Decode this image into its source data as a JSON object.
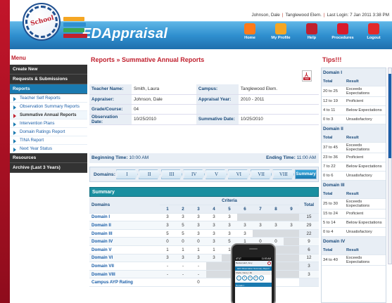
{
  "header": {
    "user": "Johnson, Dale",
    "school": "Tanglewood Elem.",
    "last_login": "Last Login: 7 Jan 2011 3:38 PM",
    "app_title": "EDAppraisal",
    "logo_text": "School",
    "nav": [
      {
        "label": "Home",
        "icon": "home-icon",
        "color": "#ff7a1a"
      },
      {
        "label": "My Profile",
        "icon": "profile-icon",
        "color": "#f5a623"
      },
      {
        "label": "Help",
        "icon": "help-icon",
        "color": "#c0202e"
      },
      {
        "label": "Procedures",
        "icon": "procedures-icon",
        "color": "#d81b2c"
      },
      {
        "label": "Logout",
        "icon": "logout-icon",
        "color": "#e22a2a"
      }
    ]
  },
  "menu": {
    "title": "Menu",
    "sections": [
      {
        "label": "Create New"
      },
      {
        "label": "Requests & Submissions"
      },
      {
        "label": "Reports",
        "items": [
          {
            "label": "Teacher Self Reports"
          },
          {
            "label": "Observation Summary Reports"
          },
          {
            "label": "Summative Annual Reports"
          },
          {
            "label": "Intervention Plans"
          },
          {
            "label": "Domain Ratings Report"
          },
          {
            "label": "TINA Report"
          },
          {
            "label": "Next Year Status"
          }
        ]
      },
      {
        "label": "Resources"
      },
      {
        "label": "Archive (Last 3 Years)"
      }
    ]
  },
  "page": {
    "title": "Reports » Summative Annual Reports",
    "pdf_label": "PDF",
    "info": {
      "teacher_label": "Teacher Name:",
      "teacher": "Smith, Laura",
      "campus_label": "Campus:",
      "campus": "Tanglewood Elem.",
      "appraiser_label": "Appraiser:",
      "appraiser": "Johnson, Dale",
      "year_label": "Appraisal Year:",
      "year": "2010 - 2011",
      "grade_label": "Grade/Course:",
      "grade": "04",
      "obs_label": "Observation Date:",
      "obs": "10/25/2010",
      "summ_label": "Summative Date:",
      "summ": "10/25/2010"
    },
    "begin_label": "Beginning Time:",
    "begin": "10:00 AM",
    "end_label": "Ending Time:",
    "end": "11:00 AM",
    "domains_label": "Domains:",
    "domain_tabs": [
      "I",
      "II",
      "III",
      "IV",
      "V",
      "VI",
      "VII",
      "VIII",
      "Summary"
    ],
    "summary": {
      "title": "Summary",
      "domains_col": "Domains",
      "criteria_col": "Criteria",
      "total_col": "Total",
      "criteria_nums": [
        "1",
        "2",
        "3",
        "4",
        "5",
        "6",
        "7",
        "8",
        "9"
      ],
      "rows": [
        {
          "name": "Domain I",
          "vals": [
            "3",
            "3",
            "3",
            "3",
            "3",
            "",
            "",
            "",
            ""
          ],
          "total": "15"
        },
        {
          "name": "Domain II",
          "vals": [
            "3",
            "5",
            "3",
            "3",
            "3",
            "3",
            "3",
            "3",
            "3"
          ],
          "total": "29"
        },
        {
          "name": "Domain III",
          "vals": [
            "5",
            "5",
            "3",
            "3",
            "3",
            "3",
            "",
            "",
            ""
          ],
          "total": "22"
        },
        {
          "name": "Domain IV",
          "vals": [
            "0",
            "0",
            "0",
            "3",
            "5",
            "1",
            "0",
            "0",
            ""
          ],
          "total": "9"
        },
        {
          "name": "Domain V",
          "vals": [
            "1",
            "1",
            "1",
            "1",
            "1",
            "1",
            "",
            "",
            ""
          ],
          "total": "6"
        },
        {
          "name": "Domain VI",
          "vals": [
            "3",
            "3",
            "3",
            "3",
            "",
            "",
            "",
            "",
            ""
          ],
          "total": "12"
        },
        {
          "name": "Domain VII",
          "vals": [
            "-",
            "-",
            "-",
            "",
            "",
            "",
            "",
            "",
            ""
          ],
          "total": "3"
        },
        {
          "name": "Domain VIII",
          "vals": [
            "-",
            "-",
            "-",
            "",
            "",
            "",
            "",
            "",
            ""
          ],
          "total": "3"
        },
        {
          "name": "Campus AYP Rating",
          "vals": [
            "",
            "",
            "0",
            "",
            "",
            "",
            "",
            "",
            ""
          ],
          "total": ""
        }
      ]
    }
  },
  "phone": {
    "status_left": "AT&T",
    "status_time": "11:53 AM",
    "bar_text": "Beckersdorf, Amy",
    "screen_title": "EDI Observation Summary Report",
    "info_text": "Shahs, Nancy | 3E",
    "rounds": [
      "I",
      "II",
      "III",
      "IV",
      "V"
    ],
    "domain_label": "Domain I"
  },
  "tips": {
    "title": "Tips!!!",
    "total_label": "Total",
    "result_label": "Result",
    "blocks": [
      {
        "domain": "Domain I",
        "rows": [
          [
            "20 to 25",
            "Exceeds Expectations"
          ],
          [
            "12 to 19",
            "Proficient"
          ],
          [
            "4 to 11",
            "Below Expectations"
          ],
          [
            "0 to 3",
            "Unsatisfactory"
          ]
        ]
      },
      {
        "domain": "Domain II",
        "rows": [
          [
            "37 to 45",
            "Exceeds Expectations"
          ],
          [
            "23 to 36",
            "Proficient"
          ],
          [
            "7 to 22",
            "Below Expectations"
          ],
          [
            "0 to 6",
            "Unsatisfactory"
          ]
        ]
      },
      {
        "domain": "Domain III",
        "rows": [
          [
            "25 to 30",
            "Exceeds Expectations"
          ],
          [
            "15 to 24",
            "Proficient"
          ],
          [
            "5 to 14",
            "Below Expectations"
          ],
          [
            "0 to 4",
            "Unsatisfactory"
          ]
        ]
      },
      {
        "domain": "Domain IV",
        "rows": [
          [
            "34 to 40",
            "Exceeds Expectations"
          ]
        ]
      }
    ]
  }
}
